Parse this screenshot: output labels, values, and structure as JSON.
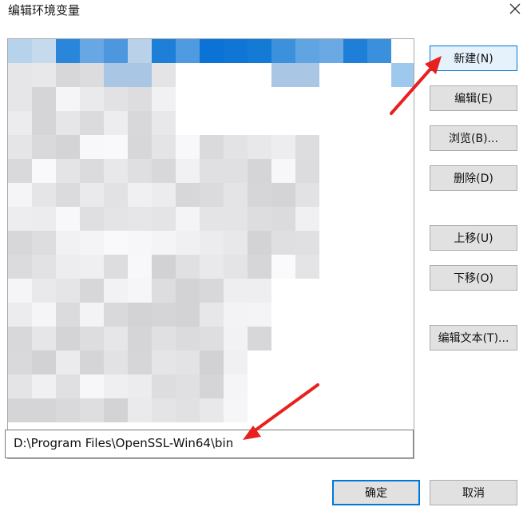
{
  "window": {
    "title": "编辑环境变量"
  },
  "path_list": {
    "last_entry": "D:\\Program Files\\OpenSSL-Win64\\bin"
  },
  "buttons": {
    "new": "新建(N)",
    "edit": "编辑(E)",
    "browse": "浏览(B)...",
    "delete": "删除(D)",
    "move_up": "上移(U)",
    "move_down": "下移(O)",
    "edit_text": "编辑文本(T)...",
    "ok": "确定",
    "cancel": "取消"
  },
  "colors": {
    "accent": "#0078d7",
    "annotation_arrow": "#e8211f"
  },
  "icons": {
    "close": "close-icon"
  }
}
